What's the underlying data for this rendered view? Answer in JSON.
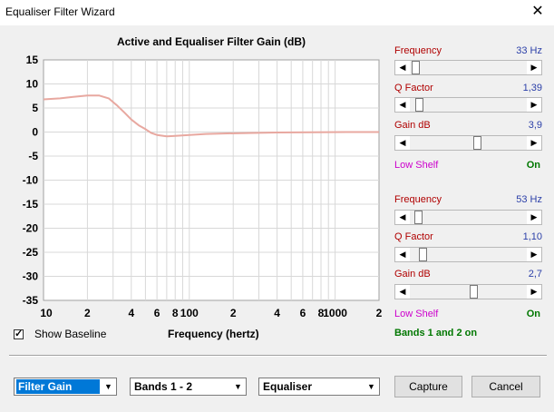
{
  "window": {
    "title": "Equaliser Filter Wizard",
    "close_glyph": "✕"
  },
  "chart_data": {
    "type": "line",
    "title": "Active and Equaliser Filter Gain (dB)",
    "xlabel": "Frequency (hertz)",
    "ylabel": "",
    "x_scale": "log",
    "xlim": [
      10,
      2000
    ],
    "ylim": [
      -35,
      15
    ],
    "y_ticks": [
      15,
      10,
      5,
      0,
      -5,
      -10,
      -15,
      -20,
      -25,
      -30,
      -35
    ],
    "x_tick_labels": [
      {
        "value": 10,
        "label": "10"
      },
      {
        "value": 20,
        "label": "2"
      },
      {
        "value": 40,
        "label": "4"
      },
      {
        "value": 60,
        "label": "6"
      },
      {
        "value": 80,
        "label": "8"
      },
      {
        "value": 100,
        "label": "100"
      },
      {
        "value": 200,
        "label": "2"
      },
      {
        "value": 400,
        "label": "4"
      },
      {
        "value": 600,
        "label": "6"
      },
      {
        "value": 800,
        "label": "8"
      },
      {
        "value": 1000,
        "label": "1000"
      },
      {
        "value": 2000,
        "label": "2"
      }
    ],
    "grid": true,
    "series": [
      {
        "color": "#e8a8a0",
        "x": [
          10,
          13,
          16,
          20,
          24,
          28,
          32,
          36,
          40,
          45,
          50,
          55,
          60,
          70,
          80,
          100,
          130,
          170,
          250,
          400,
          700,
          1200,
          2000
        ],
        "y": [
          6.8,
          7.0,
          7.3,
          7.6,
          7.6,
          7.0,
          5.5,
          4.0,
          2.6,
          1.4,
          0.6,
          -0.2,
          -0.6,
          -0.9,
          -0.8,
          -0.6,
          -0.4,
          -0.3,
          -0.2,
          -0.1,
          -0.05,
          0,
          0
        ]
      }
    ]
  },
  "band1": {
    "frequency": {
      "label": "Frequency",
      "value": "33 Hz",
      "position": 0.02
    },
    "q_factor": {
      "label": "Q Factor",
      "value": "1,39",
      "position": 0.05
    },
    "gain": {
      "label": "Gain  dB",
      "value": "3,9",
      "position": 0.58
    },
    "shelf": {
      "label": "Low Shelf",
      "value": "On"
    }
  },
  "band2": {
    "frequency": {
      "label": "Frequency",
      "value": "53 Hz",
      "position": 0.04
    },
    "q_factor": {
      "label": "Q Factor",
      "value": "1,10",
      "position": 0.08
    },
    "gain": {
      "label": "Gain  dB",
      "value": "2,7",
      "position": 0.55
    },
    "shelf": {
      "label": "Low Shelf",
      "value": "On"
    }
  },
  "bands_status": "Bands 1 and 2 on",
  "show_baseline": {
    "label": "Show Baseline",
    "checked": true,
    "check_glyph": "✓"
  },
  "controls": {
    "filter_select": "Filter Gain",
    "bands_select": "Bands 1 - 2",
    "mode_select": "Equaliser",
    "dropdown_glyph": "▼",
    "capture_label": "Capture",
    "cancel_label": "Cancel"
  },
  "arrows": {
    "left": "◀",
    "right": "▶"
  }
}
